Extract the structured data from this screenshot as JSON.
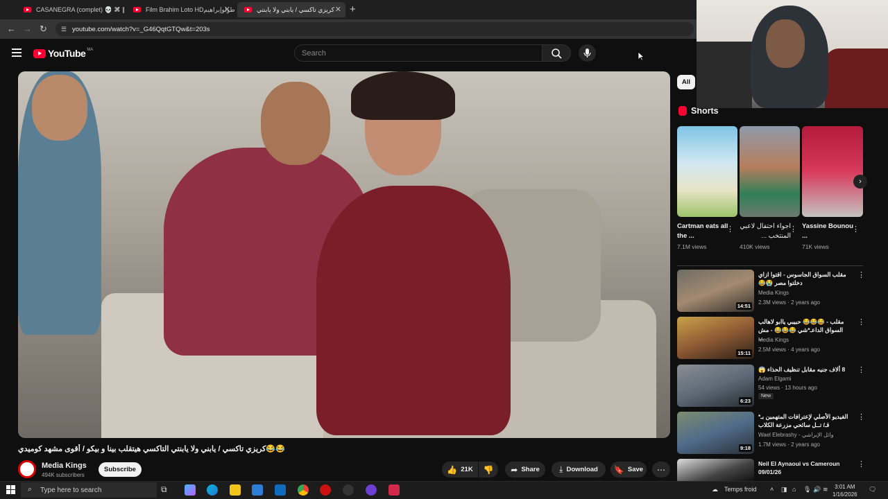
{
  "browser": {
    "tabs": [
      {
        "label": "CASANEGRA (complet) 💀 ⌘ ∥"
      },
      {
        "label": "Film Brahim Loto HDبوطولوإبراهيم"
      },
      {
        "label": "كريزي تاكسي / يابني ولا يابنتي"
      }
    ],
    "url": "youtube.com/watch?v=_G46QqtGTQw&t=203s"
  },
  "header": {
    "logo": "YouTube",
    "country": "MA",
    "search_placeholder": "Search"
  },
  "video": {
    "title": "😂😂كريزي تاكسي / يابني ولا يابنتي التاكسي هيتقلب بينا و بيكو / أقوى مشهد كوميدي",
    "channel": "Media Kings",
    "subscribers": "494K subscribers",
    "subscribe_label": "Subscribe",
    "likes": "21K",
    "share_label": "Share",
    "download_label": "Download",
    "save_label": "Save"
  },
  "sidebar": {
    "chip_all": "All",
    "shorts_header": "Shorts",
    "shorts": [
      {
        "title": "Cartman eats all the ...",
        "views": "7.1M views"
      },
      {
        "title": "اجواء احتفال لاعبي المنتخب ...",
        "views": "410K views"
      },
      {
        "title": "Yassine Bounou ...",
        "views": "71K views"
      }
    ],
    "videos": [
      {
        "title": "مقلب السواق الجاسوس - اقتوا ازاي دخلتوا مصر 😭😂",
        "channel": "Media Kings",
        "meta": "2.3M views · 2 years ago",
        "duration": "14:51"
      },
      {
        "title": "مقلب - 😂😂😂 حبيبي ياابو لاهالب السواق الداعـ*شي 😂😂😂 - مش ...",
        "channel": "Media Kings",
        "meta": "2.5M views · 4 years ago",
        "duration": "15:11"
      },
      {
        "title": "8 ألاف جنيه مقابل تنظيف الحذاء 😱",
        "channel": "Adam Elgami",
        "meta": "54 views · 13 hours ago",
        "duration": "6:23",
        "badge": "New"
      },
      {
        "title": "الفيديو الأصلي لإعترافات المتهمين بـ* قـ/ تــل سائحي مزرعة الكلاب",
        "channel": "Wael Elebrashy - وائل الإبراشي",
        "meta": "1.7M views · 2 years ago",
        "duration": "9:18"
      },
      {
        "title": "Neil El Aynaoui vs Cameroun 09/01/26",
        "channel": "",
        "meta": "",
        "duration": ""
      }
    ]
  },
  "taskbar": {
    "search_placeholder": "Type here to search",
    "weather": "Temps froid",
    "time": "3:01 AM",
    "date": "1/16/2026"
  }
}
